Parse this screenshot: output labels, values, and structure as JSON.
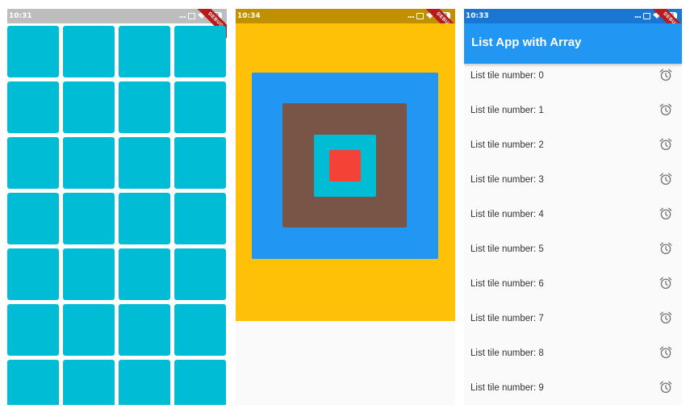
{
  "colors": {
    "grid_tile": "#00bcd4",
    "yellow": "#ffc107",
    "blue": "#2196f3",
    "brown": "#795548",
    "cyan": "#00bcd4",
    "red": "#f44336",
    "appbar": "#2196f3"
  },
  "screens": [
    {
      "status_time": "10:31",
      "status_bar_color": "#bdbdbd",
      "debug_banner": "DEBUG",
      "grid": {
        "columns": 4,
        "visible_rows": 7
      }
    },
    {
      "status_time": "10:34",
      "status_bar_color": "#c09000",
      "debug_banner": "DEBUG"
    },
    {
      "status_time": "10:33",
      "status_bar_color": "#1976d2",
      "debug_banner": "DEBUG",
      "app_title": "List App with Array",
      "list_items": [
        "List tile number: 0",
        "List tile number: 1",
        "List tile number: 2",
        "List tile number: 3",
        "List tile number: 4",
        "List tile number: 5",
        "List tile number: 6",
        "List tile number: 7",
        "List tile number: 8",
        "List tile number: 9"
      ],
      "trailing_icon": "alarm-clock-icon"
    }
  ],
  "status_icons": {
    "overflow": "...",
    "battery": "88"
  }
}
